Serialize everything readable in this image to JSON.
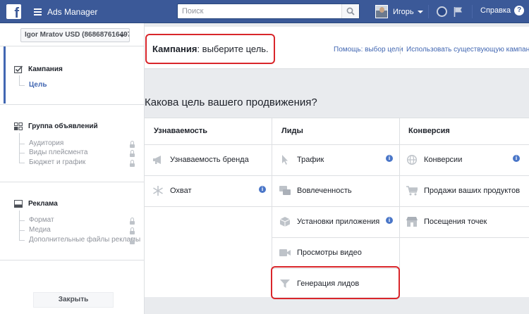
{
  "topbar": {
    "logo": "f",
    "app_name": "Ads Manager",
    "search_placeholder": "Поиск",
    "user_name": "Игорь",
    "help_label": "Справка",
    "help_icon": "?",
    "brand_color": "#3b5998"
  },
  "sidebar": {
    "account": "Igor Mratov USD (868687616497...",
    "campaign": {
      "label": "Кампания",
      "sub": "Цель"
    },
    "adset": {
      "label": "Группа объявлений",
      "items": [
        "Аудитория",
        "Виды плейсмента",
        "Бюджет и график"
      ]
    },
    "ad": {
      "label": "Реклама",
      "items": [
        "Формат",
        "Медиа",
        "Дополнительные файлы рекламы"
      ]
    },
    "close_label": "Закрыть"
  },
  "header": {
    "title_bold": "Кампания",
    "title_rest": ": выберите цель.",
    "help_link": "Помощь: выбор цели",
    "existing_link": "Использовать существующую кампанию"
  },
  "question": "Какова цель вашего продвижения?",
  "columns": [
    {
      "title": "Узнаваемость",
      "options": [
        {
          "label": "Узнаваемость бренда",
          "icon": "megaphone-icon",
          "info": false
        },
        {
          "label": "Охват",
          "icon": "snowflake-icon",
          "info": true
        }
      ]
    },
    {
      "title": "Лиды",
      "options": [
        {
          "label": "Трафик",
          "icon": "cursor-icon",
          "info": true
        },
        {
          "label": "Вовлеченность",
          "icon": "chat-icon",
          "info": false
        },
        {
          "label": "Установки приложения",
          "icon": "box-icon",
          "info": true
        },
        {
          "label": "Просмотры видео",
          "icon": "video-icon",
          "info": false
        },
        {
          "label": "Генерация лидов",
          "icon": "funnel-icon",
          "info": false
        }
      ]
    },
    {
      "title": "Конверсия",
      "options": [
        {
          "label": "Конверсии",
          "icon": "globe-icon",
          "info": true
        },
        {
          "label": "Продажи ваших продуктов",
          "icon": "cart-icon",
          "info": false
        },
        {
          "label": "Посещения точек",
          "icon": "store-icon",
          "info": false
        }
      ]
    }
  ],
  "info_glyph": "i"
}
